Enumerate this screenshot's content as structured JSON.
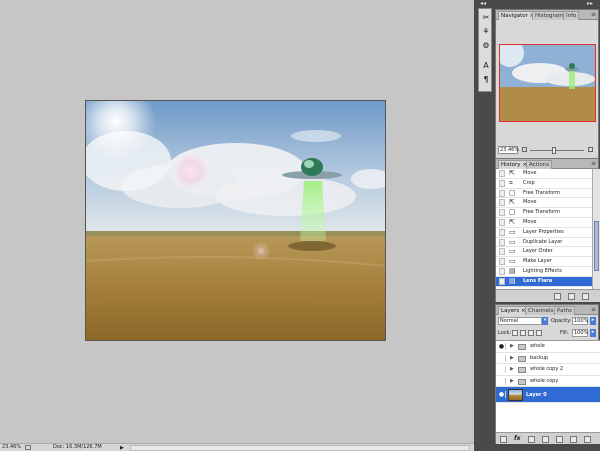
{
  "status_bar": {
    "zoom": "23.46%",
    "doc_info": "Doc: 16.3M/126.7M",
    "arrow": "▶"
  },
  "navigator_panel": {
    "tabs": [
      {
        "label": "Navigator ×",
        "active": true
      },
      {
        "label": "Histogram",
        "active": false
      },
      {
        "label": "Info",
        "active": false
      }
    ],
    "zoom_value": "23.46%",
    "menu_icon": "≡"
  },
  "history_panel": {
    "tabs": [
      {
        "label": "History ×",
        "active": true
      },
      {
        "label": "Actions",
        "active": false
      }
    ],
    "items": [
      {
        "label": "Move",
        "icon": "move-icon"
      },
      {
        "label": "Crop",
        "icon": "crop-icon"
      },
      {
        "label": "Free Transform",
        "icon": "transform-icon"
      },
      {
        "label": "Move",
        "icon": "move-icon"
      },
      {
        "label": "Free Transform",
        "icon": "transform-icon"
      },
      {
        "label": "Move",
        "icon": "move-icon"
      },
      {
        "label": "Layer Properties",
        "icon": "layer-icon"
      },
      {
        "label": "Duplicate Layer",
        "icon": "layer-icon"
      },
      {
        "label": "Layer Order",
        "icon": "layer-icon"
      },
      {
        "label": "Make Layer",
        "icon": "layer-icon"
      },
      {
        "label": "Lighting Effects",
        "icon": "filter-icon"
      },
      {
        "label": "Lens Flare",
        "icon": "filter-icon",
        "selected": true
      }
    ]
  },
  "layers_panel": {
    "tabs": [
      {
        "label": "Layers ×",
        "active": true
      },
      {
        "label": "Channels",
        "active": false
      },
      {
        "label": "Paths",
        "active": false
      }
    ],
    "blend_mode": "Normal",
    "opacity_label": "Opacity:",
    "opacity": "100%",
    "lock_label": "Lock:",
    "fill_label": "Fill:",
    "fill": "100%",
    "layers": [
      {
        "name": "whole",
        "visible": true,
        "type": "group"
      },
      {
        "name": "backup",
        "visible": false,
        "type": "group"
      },
      {
        "name": "whole copy 2",
        "visible": false,
        "type": "group"
      },
      {
        "name": "whole copy",
        "visible": false,
        "type": "group"
      },
      {
        "name": "Layer 0",
        "visible": true,
        "type": "image",
        "selected": true
      }
    ],
    "fx_label": "fx"
  },
  "colors": {
    "selection_blue": "#2f6bd3",
    "dock_dark": "#4a4a4a",
    "workspace_gray": "#c6c6c6",
    "navigator_frame_red": "#e03030"
  }
}
